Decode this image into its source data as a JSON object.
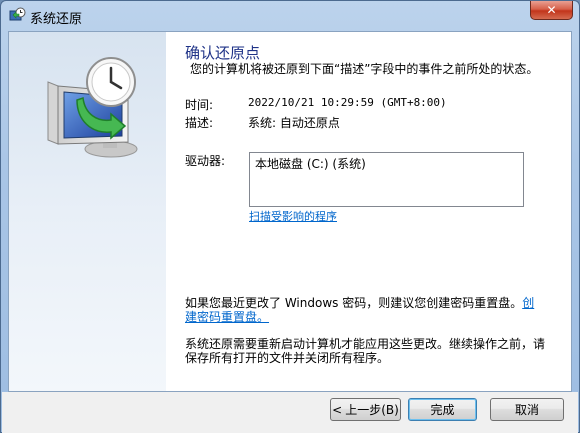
{
  "window": {
    "title": "系统还原",
    "close_symbol": "✕"
  },
  "main": {
    "heading": "确认还原点",
    "description": "您的计算机将被还原到下面“描述”字段中的事件之前所处的状态。",
    "time_label": "时间:",
    "time_value": "2022/10/21 10:29:59 (GMT+8:00)",
    "desc_label": "描述:",
    "desc_value": "系统: 自动还原点",
    "drives_label": "驱动器:",
    "drive_items": [
      "本地磁盘 (C:) (系统)"
    ],
    "scan_link": "扫描受影响的程序",
    "password_text": "如果您最近更改了 Windows 密码，则建议您创建密码重置盘。",
    "password_link": "创建密码重置盘。",
    "restart_text": "系统还原需要重新启动计算机才能应用这些更改。继续操作之前，请保存所有打开的文件并关闭所有程序。"
  },
  "footer": {
    "back_label": "上一步(B)",
    "back_arrow": "<",
    "finish_label": "完成",
    "cancel_label": "取消"
  },
  "colors": {
    "heading": "#1e3287",
    "link": "#0066cc",
    "close_button": "#c2351b"
  },
  "icons": {
    "title": "system-restore-icon",
    "illustration": "computer-restore-clock-icon"
  }
}
